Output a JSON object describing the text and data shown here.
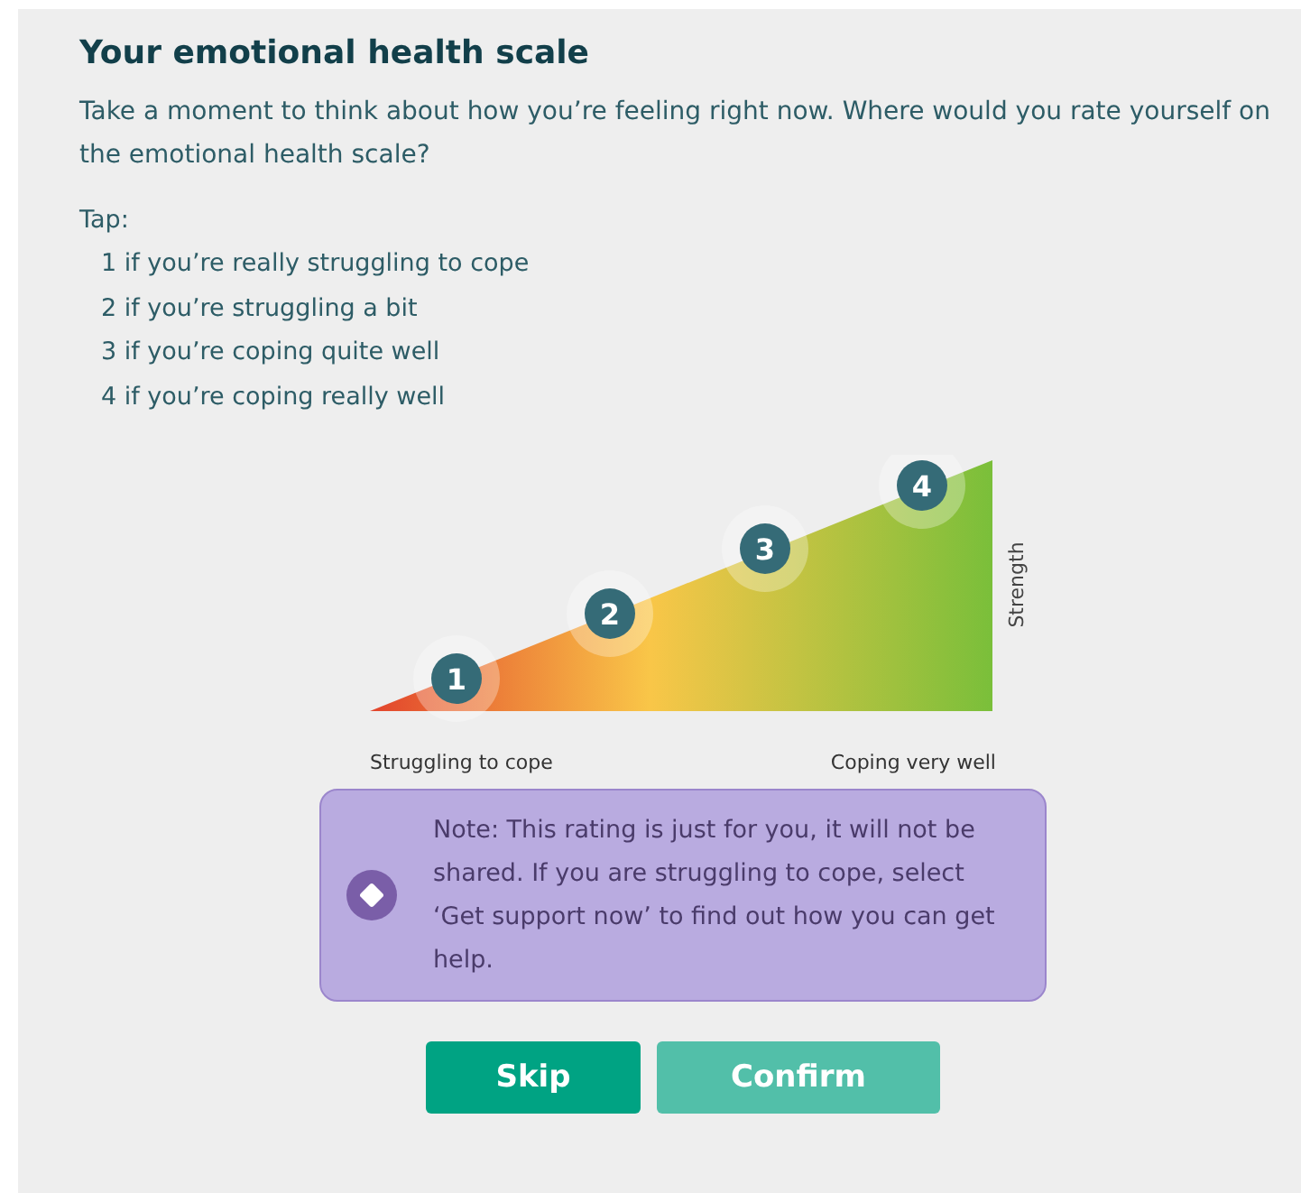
{
  "title": "Your emotional health scale",
  "intro": "Take a moment to think about how you’re feeling right now. Where would you rate yourself on the emotional health scale?",
  "tap_label": "Tap:",
  "options": [
    {
      "text": "1 if you’re really struggling to cope"
    },
    {
      "text": "2 if you’re struggling a bit"
    },
    {
      "text": "3 if you’re coping quite well"
    },
    {
      "text": "4 if you’re coping really well"
    }
  ],
  "scale": {
    "markers": [
      {
        "label": "1"
      },
      {
        "label": "2"
      },
      {
        "label": "3"
      },
      {
        "label": "4"
      }
    ],
    "axis_label": "Strength",
    "low_label": "Struggling to cope",
    "high_label": "Coping very well"
  },
  "note": "Note: This rating is just for you, it will not be shared. If you are struggling to cope, select ‘Get support now’ to find out how you can get help.",
  "buttons": [
    {
      "label": "Skip",
      "disabled": false
    },
    {
      "label": "Confirm",
      "disabled": true
    }
  ]
}
